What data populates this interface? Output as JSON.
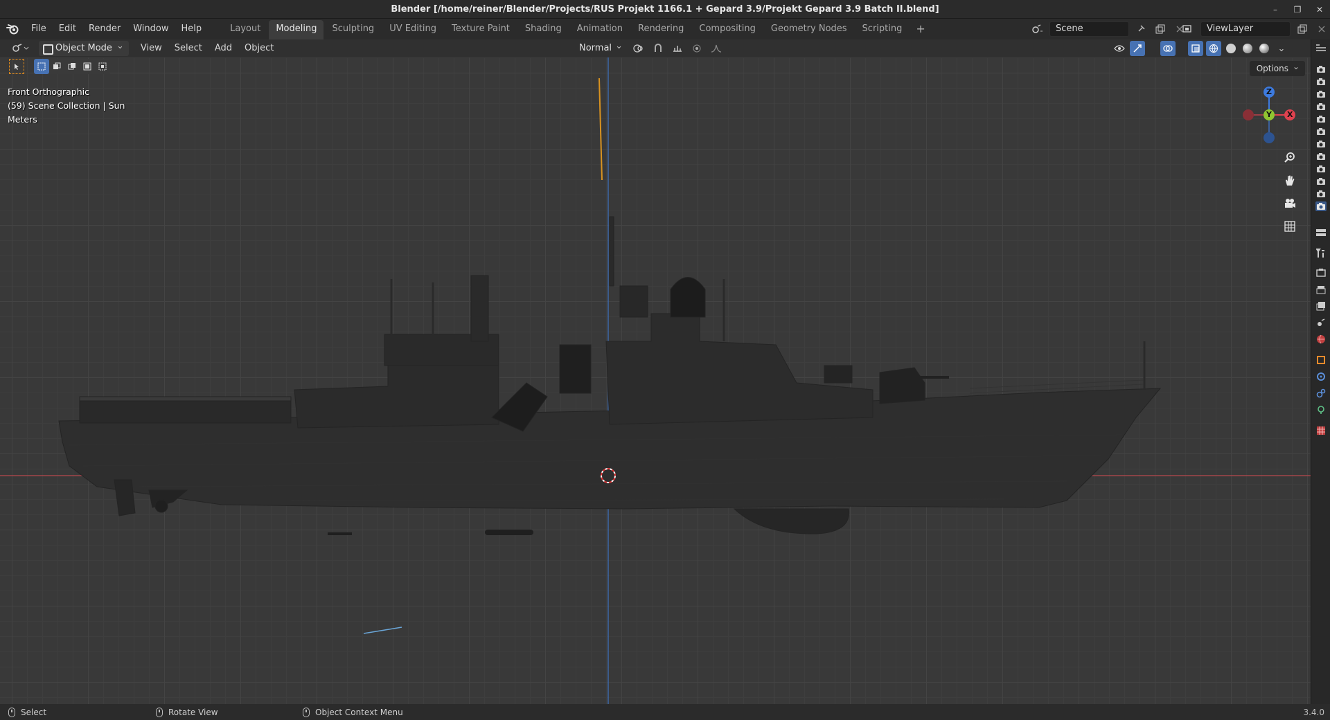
{
  "window": {
    "title": "Blender [/home/reiner/Blender/Projects/RUS Projekt 1166.1 + Gepard 3.9/Projekt Gepard 3.9 Batch II.blend]",
    "controls": [
      "–",
      "❐",
      "✕"
    ]
  },
  "menu": [
    "File",
    "Edit",
    "Render",
    "Window",
    "Help"
  ],
  "workspaces": {
    "tabs": [
      "Layout",
      "Modeling",
      "Sculpting",
      "UV Editing",
      "Texture Paint",
      "Shading",
      "Animation",
      "Rendering",
      "Compositing",
      "Geometry Nodes",
      "Scripting"
    ],
    "active": "Modeling",
    "add": "+"
  },
  "scene": {
    "name": "Scene"
  },
  "view_layer": {
    "name": "ViewLayer"
  },
  "viewport_header": {
    "mode": "Object Mode",
    "menus": [
      "View",
      "Select",
      "Add",
      "Object"
    ],
    "orientation": "Normal"
  },
  "tool_row": {
    "options": "Options"
  },
  "viewport_overlay": {
    "view_name": "Front Orthographic",
    "collection": "(59) Scene Collection | Sun",
    "units": "Meters"
  },
  "gizmo": {
    "z": "Z",
    "y": "Y",
    "x": "X"
  },
  "colors": {
    "accent": "#4772b3",
    "x_axis": "#e0424f",
    "y_axis": "#8fc531",
    "z_axis": "#3d7be0",
    "active_tab": "#3d3d3d"
  },
  "statusbar": {
    "items": [
      "Select",
      "Rotate View",
      "Object Context Menu"
    ],
    "version": "3.4.0"
  }
}
